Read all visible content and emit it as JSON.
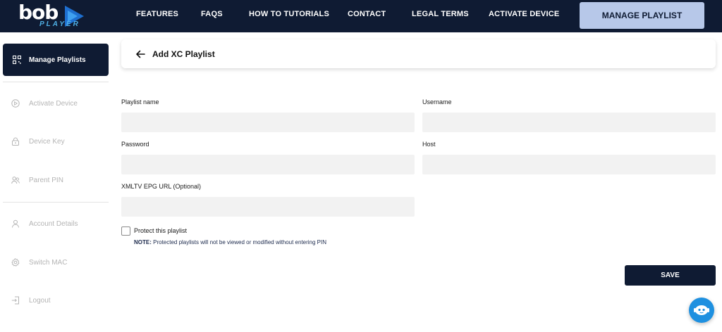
{
  "brand": {
    "logo_text": "bob",
    "logo_subtext": "PLAYER"
  },
  "nav": {
    "links": [
      "FEATURES",
      "FAQS",
      "HOW TO TUTORIALS",
      "CONTACT",
      "LEGAL TERMS",
      "ACTIVATE DEVICE"
    ],
    "cta_label": "MANAGE PLAYLIST"
  },
  "sidebar": {
    "active_item": {
      "label": "Manage Playlists",
      "icon": "grid-icon"
    },
    "items": [
      {
        "label": "Activate Device",
        "icon": "play-circle-icon"
      },
      {
        "label": "Device Key",
        "icon": "lock-icon"
      },
      {
        "label": "Parent PIN",
        "icon": "users-icon"
      },
      {
        "label": "Account Details",
        "icon": "user-icon"
      },
      {
        "label": "Switch MAC",
        "icon": "gear-icon"
      },
      {
        "label": "Logout",
        "icon": "logout-icon"
      }
    ]
  },
  "header": {
    "title": "Add XC Playlist"
  },
  "form": {
    "playlist_name": {
      "label": "Playlist name",
      "value": ""
    },
    "username": {
      "label": "Username",
      "value": ""
    },
    "password": {
      "label": "Password",
      "value": ""
    },
    "host": {
      "label": "Host",
      "value": ""
    },
    "epg_url": {
      "label": "XMLTV EPG URL (Optional)",
      "value": ""
    },
    "protect": {
      "label": "Protect this playlist",
      "checked": false
    },
    "note_prefix": "NOTE:",
    "note_text": " Protected playlists will not be viewed or modified without entering PIN",
    "save_label": "SAVE"
  },
  "colors": {
    "primary": "#0f1b33",
    "cta": "#b7c8e9",
    "input_bg": "#f2f2f2",
    "chat": "#1e90e0"
  }
}
